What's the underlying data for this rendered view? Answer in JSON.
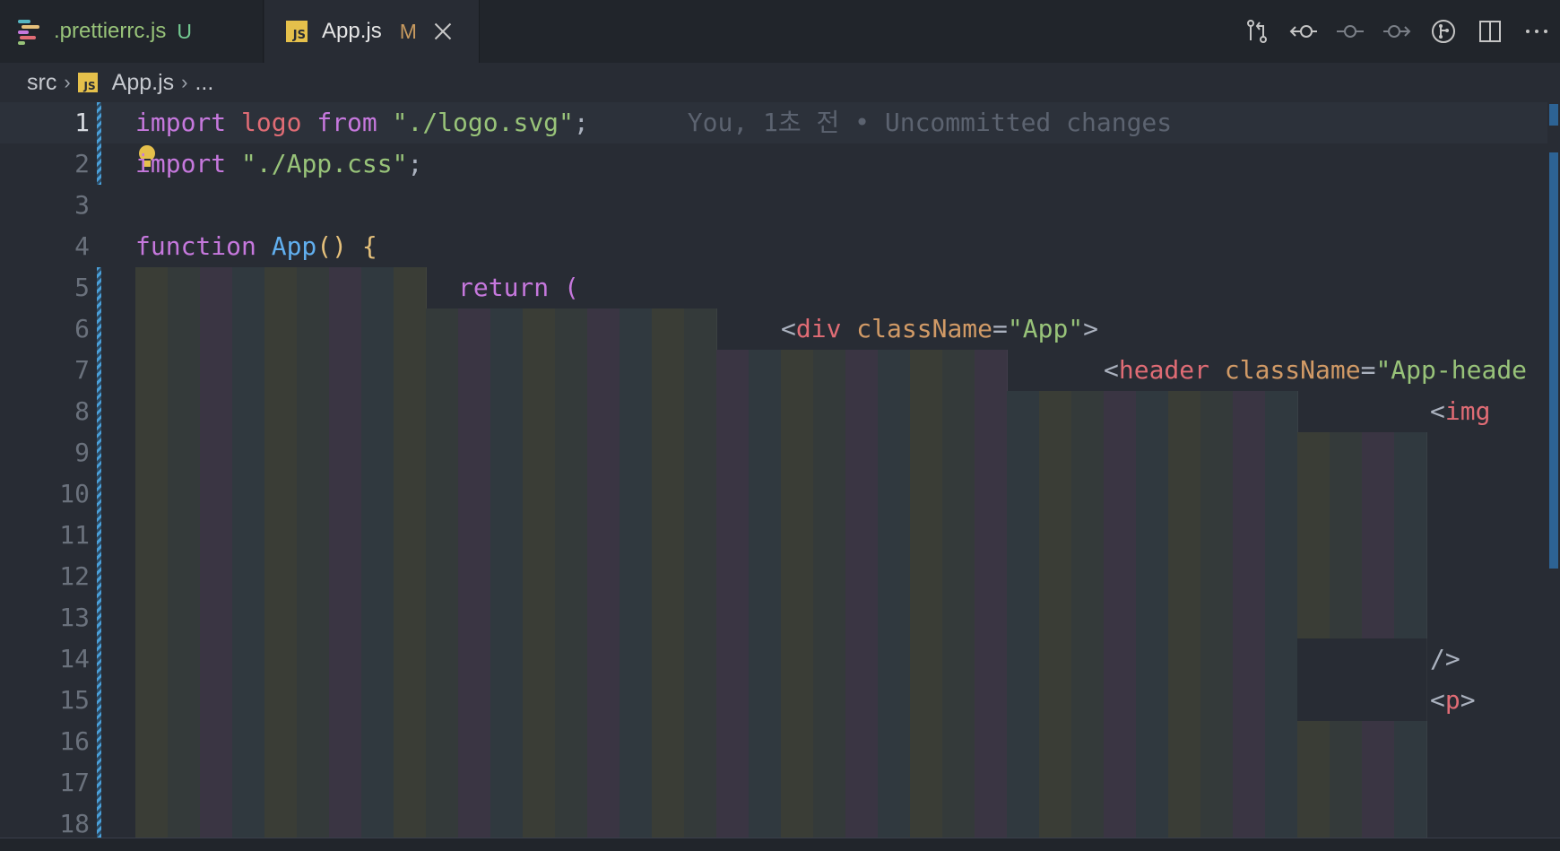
{
  "tabs": [
    {
      "label": ".prettierrc.js",
      "badge": "U",
      "icon": "prettier-icon"
    },
    {
      "label": "App.js",
      "badge": "M",
      "icon": "js-file-icon",
      "active": true
    }
  ],
  "js_icon_text": "JS",
  "toolbar_actions": [
    {
      "name": "open-changes-icon"
    },
    {
      "name": "previous-change-icon"
    },
    {
      "name": "commit-icon"
    },
    {
      "name": "next-change-icon"
    },
    {
      "name": "git-graph-icon"
    },
    {
      "name": "split-editor-icon"
    },
    {
      "name": "more-actions-icon"
    }
  ],
  "breadcrumb": {
    "folder": "src",
    "file": "App.js",
    "rest": "..."
  },
  "line_numbers": [
    "1",
    "2",
    "3",
    "4",
    "5",
    "6",
    "7",
    "8",
    "9",
    "10",
    "11",
    "12",
    "13",
    "14",
    "15",
    "16",
    "17",
    "18"
  ],
  "code": {
    "l1": {
      "import": "import",
      "logo": "logo",
      "from": "from",
      "path": "\"./logo.svg\"",
      "semi": ";"
    },
    "blame": "You, 1초 전 • Uncommitted changes",
    "l2": {
      "import": "import",
      "path": "\"./App.css\"",
      "semi": ";"
    },
    "l4": {
      "function": "function",
      "name": "App",
      "parens": "()",
      "brace": "{"
    },
    "l5": {
      "return": "return",
      "paren": "("
    },
    "l6": {
      "open": "<",
      "tag": "div",
      "attr": "className",
      "eq": "=",
      "val": "\"App\"",
      "close": ">"
    },
    "l7": {
      "open": "<",
      "tag": "header",
      "attr": "className",
      "eq": "=",
      "val": "\"App-heade"
    },
    "l8": {
      "open": "<",
      "tag": "img"
    },
    "l14": {
      "selfclose": "/>"
    },
    "l15": {
      "open": "<",
      "tag": "p",
      "close": ">"
    }
  },
  "colors": {
    "background": "#282c34",
    "keyword": "#c678dd",
    "string": "#98c379",
    "function": "#61afef",
    "tag": "#e06c75",
    "attribute": "#d19a66"
  }
}
